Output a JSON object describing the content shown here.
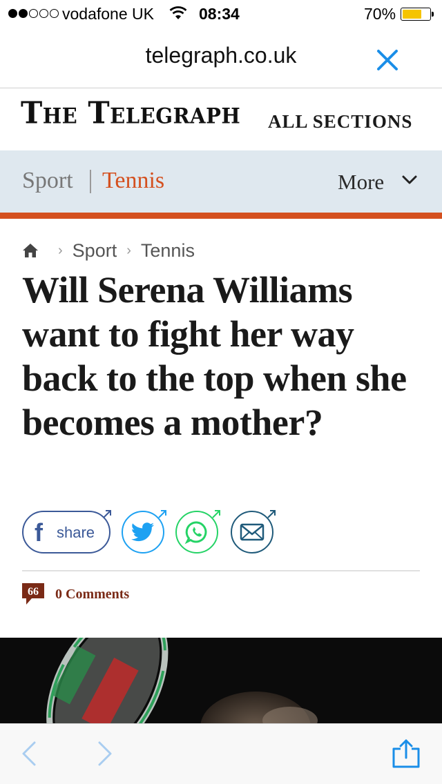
{
  "status_bar": {
    "carrier": "vodafone UK",
    "time": "08:34",
    "battery_percent": "70%",
    "battery_level": 0.7,
    "signal_bars_filled": 2,
    "signal_bars_total": 5
  },
  "browser": {
    "url": "telegraph.co.uk",
    "close_icon": "close-icon",
    "back_icon": "back-chevron-icon",
    "forward_icon": "forward-chevron-icon",
    "share_icon": "share-icon"
  },
  "masthead": {
    "logo_text": "The Telegraph",
    "all_sections_label": "ALL SECTIONS"
  },
  "section_nav": {
    "parent": "Sport",
    "current": "Tennis",
    "more_label": "More",
    "accent_color": "#d4501f",
    "background_color": "#dfe8ef"
  },
  "breadcrumb": {
    "items": [
      "Sport",
      "Tennis"
    ]
  },
  "article": {
    "headline": "Will Serena Williams want to fight her way back to the top when she becomes a mother?",
    "share_label": "share",
    "comments_label": "0 Comments"
  },
  "share_buttons": [
    {
      "name": "facebook",
      "icon": "facebook-icon",
      "color": "#3b5998"
    },
    {
      "name": "twitter",
      "icon": "twitter-icon",
      "color": "#1da1f2"
    },
    {
      "name": "whatsapp",
      "icon": "whatsapp-icon",
      "color": "#25d366"
    },
    {
      "name": "email",
      "icon": "email-icon",
      "color": "#1f5a7a"
    }
  ]
}
